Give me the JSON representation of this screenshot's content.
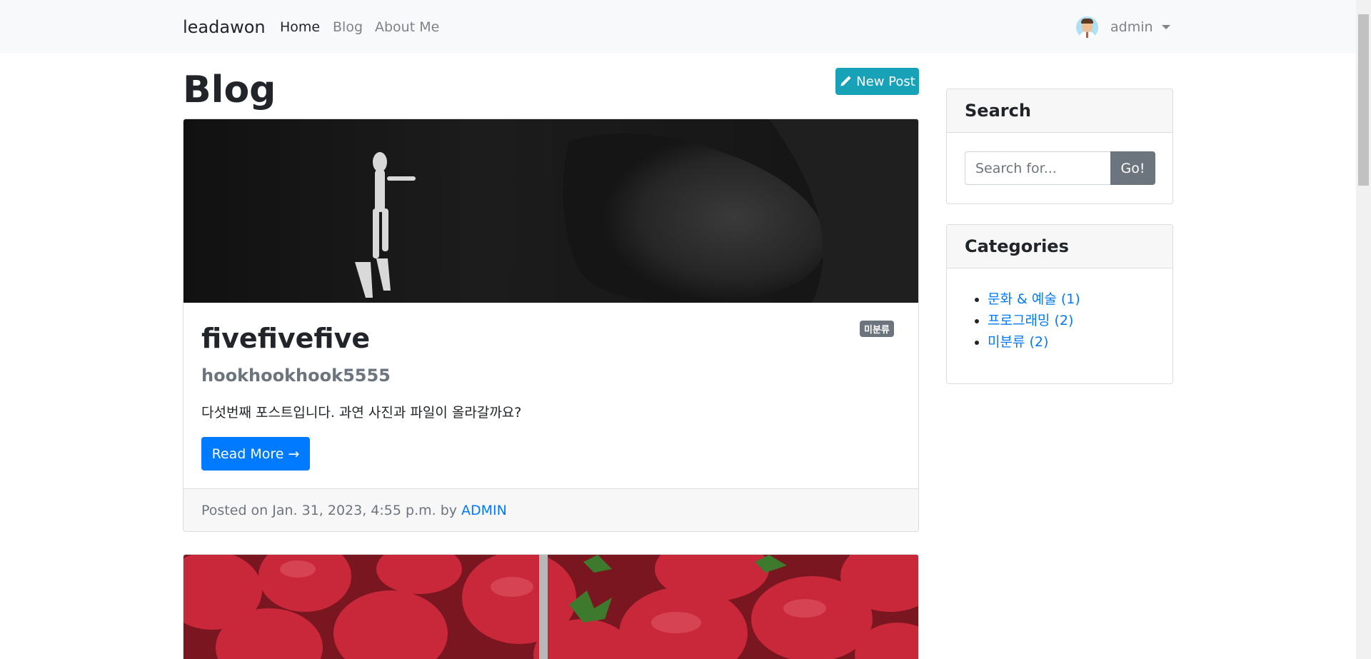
{
  "navbar": {
    "brand": "leadawon",
    "links": [
      {
        "label": "Home",
        "active": true
      },
      {
        "label": "Blog",
        "active": false
      },
      {
        "label": "About Me",
        "active": false
      }
    ],
    "user": {
      "name": "admin",
      "avatar_icon": "avatar-icon"
    }
  },
  "main": {
    "title": "Blog",
    "new_post_label": "New Post",
    "posts": [
      {
        "image": "scuba-diver-photo",
        "category_badge": "미분류",
        "title": "fivefivefive",
        "subtitle": "hookhookhook5555",
        "excerpt": "다섯번째 포스트입니다. 과연 사진과 파일이 올라갈까요?",
        "read_more_label": "Read More →",
        "footer_prefix": "Posted on Jan. 31, 2023, 4:55 p.m. by",
        "author": "ADMIN"
      },
      {
        "image": "strawberries-photo"
      }
    ]
  },
  "sidebar": {
    "search": {
      "title": "Search",
      "placeholder": "Search for...",
      "button_label": "Go!"
    },
    "categories": {
      "title": "Categories",
      "items": [
        {
          "label": "문화 & 예술 (1)"
        },
        {
          "label": "프로그래밍 (2)"
        },
        {
          "label": "미분류 (2)"
        }
      ]
    }
  },
  "colors": {
    "primary": "#007bff",
    "info": "#17a2b8",
    "secondary": "#6c757d",
    "navbar_bg": "#f8f9fa"
  }
}
